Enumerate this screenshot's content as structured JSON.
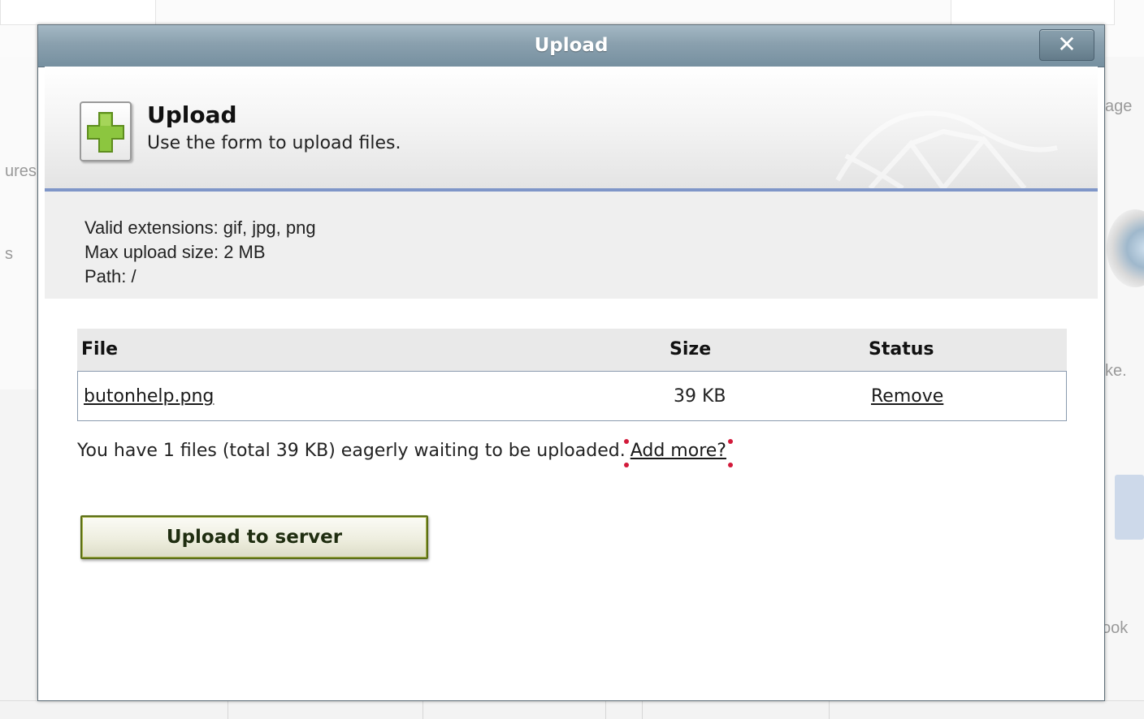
{
  "dialog": {
    "title": "Upload",
    "close_label": "✕"
  },
  "header": {
    "title": "Upload",
    "subtitle": "Use the form to upload files.",
    "icon": "plus-icon"
  },
  "info": {
    "extensions": "Valid extensions: gif, jpg, png",
    "max_size": "Max upload size: 2 MB",
    "path": "Path: /"
  },
  "table": {
    "headers": {
      "file": "File",
      "size": "Size",
      "status": "Status"
    },
    "rows": [
      {
        "file": "butonhelp.png",
        "size": "39 KB",
        "action": "Remove"
      }
    ]
  },
  "summary": {
    "text": "You have 1 files (total 39 KB) eagerly waiting to be uploaded.",
    "add_more": "Add more?"
  },
  "upload_button": "Upload to server",
  "background": {
    "left_texts": [
      "ures",
      "s"
    ],
    "right_texts": [
      "age",
      "ke.",
      "ook"
    ]
  },
  "colors": {
    "titlebar": "#8aa0ae",
    "accent_line": "#7f96c8",
    "button_border": "#5b6e16",
    "plus_green": "#8cc63f",
    "marker_red": "#d21a3a"
  }
}
